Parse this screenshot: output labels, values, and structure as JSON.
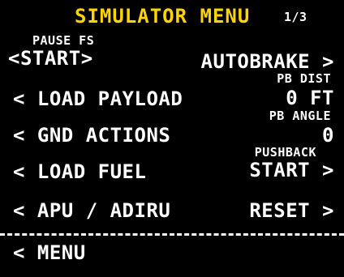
{
  "header": {
    "title": "SIMULATOR MENU",
    "page": "1/3"
  },
  "left": {
    "l1_label": "PAUSE FS",
    "l1_value": "<START>",
    "l2_value": "< LOAD PAYLOAD",
    "l3_value": "< GND ACTIONS",
    "l4_value": "< LOAD FUEL",
    "l5_value": "< APU / ADIRU",
    "l6_value": "< MENU"
  },
  "right": {
    "r1_value": "AUTOBRAKE >",
    "r2_label": "PB DIST",
    "r2_value": "0 FT",
    "r3_label": "PB ANGLE",
    "r3_value": "0",
    "r4_label": "PUSHBACK",
    "r4_value": "START >",
    "r5_value": "RESET >"
  },
  "colors": {
    "background": "#000000",
    "text": "#ffffff",
    "title": "#ffd400"
  }
}
